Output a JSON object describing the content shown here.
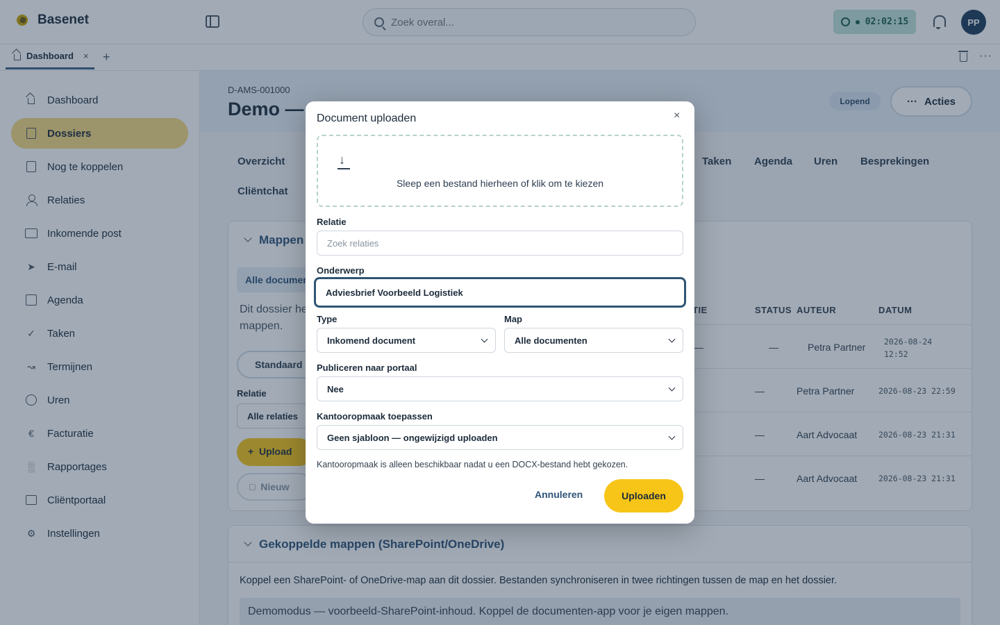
{
  "app": {
    "name": "Basenet"
  },
  "search": {
    "placeholder": "Zoek overal..."
  },
  "timer": {
    "time": "02:02:15"
  },
  "user": {
    "initials": "PP"
  },
  "tabs": [
    {
      "label": "Dashboard",
      "close": "×"
    }
  ],
  "tab_add": "+",
  "more_glyph": "···",
  "sidebar": {
    "items": [
      {
        "label": "Dashboard",
        "icon": "home-icon"
      },
      {
        "label": "Dossiers",
        "icon": "folder-file-icon",
        "active": true
      },
      {
        "label": "Nog te koppelen",
        "icon": "file-icon"
      },
      {
        "label": "Relaties",
        "icon": "person-icon"
      },
      {
        "label": "Inkomende post",
        "icon": "inbox-icon"
      },
      {
        "label": "E-mail",
        "icon": "send-icon"
      },
      {
        "label": "Agenda",
        "icon": "calendar-icon"
      },
      {
        "label": "Taken",
        "icon": "check-icon"
      },
      {
        "label": "Termijnen",
        "icon": "chart-line-icon"
      },
      {
        "label": "Uren",
        "icon": "clock-icon"
      },
      {
        "label": "Facturatie",
        "icon": "euro-icon"
      },
      {
        "label": "Rapportages",
        "icon": "bar-chart-icon"
      },
      {
        "label": "Cliëntportaal",
        "icon": "panel-icon"
      },
      {
        "label": "Instellingen",
        "icon": "gear-icon"
      }
    ]
  },
  "dossier": {
    "code": "D-AMS-001000",
    "title": "Demo — ",
    "status": "Lopend",
    "actions_label": "Acties"
  },
  "detail_tabs": [
    "Overzicht",
    "Taken",
    "Agenda",
    "Uren",
    "Besprekingen",
    "Cliëntchat"
  ],
  "mappen_card": {
    "title": "Mappen",
    "folder_chip": "Alle documen",
    "info_text_1": "Dit dossier he",
    "info_text_2": "mappen.",
    "standard_btn": "Standaard",
    "relatie_label": "Relatie",
    "relatie_value": "Alle relaties",
    "upload_btn": "Upload",
    "new_btn": "Nieuw"
  },
  "documents_table": {
    "headers": [
      "TIE",
      "STATUS",
      "AUTEUR",
      "DATUM"
    ],
    "rows": [
      {
        "rel": "—",
        "status": "—",
        "author": "Petra Partner",
        "date_line1": "2026-08-24",
        "date_line2": "12:52"
      },
      {
        "rel": "",
        "status": "—",
        "author": "Petra Partner",
        "date_line1": "2026-08-23 22:59",
        "date_line2": ""
      },
      {
        "rel": "",
        "status": "—",
        "author": "Aart Advocaat",
        "date_line1": "2026-08-23 21:31",
        "date_line2": ""
      },
      {
        "rel": "",
        "status": "—",
        "author": "Aart Advocaat",
        "date_line1": "2026-08-23 21:31",
        "date_line2": ""
      }
    ]
  },
  "linked_folders": {
    "title": "Gekoppelde mappen (SharePoint/OneDrive)",
    "description": "Koppel een SharePoint- of OneDrive-map aan dit dossier. Bestanden synchroniseren in twee richtingen tussen de map en het dossier.",
    "demo_notice": "Demomodus — voorbeeld-SharePoint-inhoud. Koppel de documenten-app voor je eigen mappen."
  },
  "modal": {
    "title": "Document uploaden",
    "close": "×",
    "dropzone_text": "Sleep een bestand hierheen of klik om te kiezen",
    "relatie_label": "Relatie",
    "relatie_placeholder": "Zoek relaties",
    "onderwerp_label": "Onderwerp",
    "onderwerp_value": "Adviesbrief Voorbeeld Logistiek",
    "type_label": "Type",
    "type_value": "Inkomend document",
    "map_label": "Map",
    "map_value": "Alle documenten",
    "portaal_label": "Publiceren naar portaal",
    "portaal_value": "Nee",
    "opmaak_label": "Kantooropmaak toepassen",
    "opmaak_value": "Geen sjabloon — ongewijzigd uploaden",
    "help_text": "Kantooropmaak is alleen beschikbaar nadat u een DOCX-bestand hebt gekozen.",
    "cancel_label": "Annuleren",
    "upload_label": "Uploaden"
  }
}
